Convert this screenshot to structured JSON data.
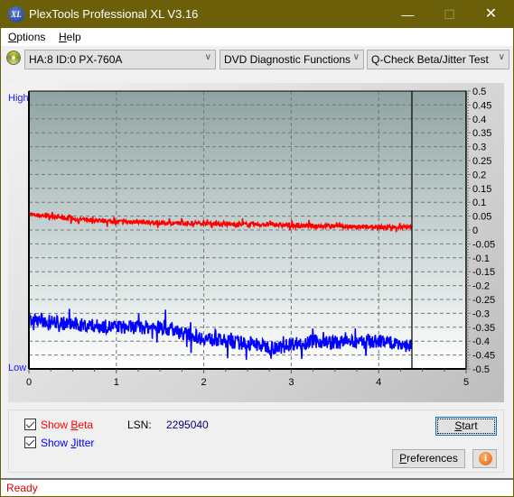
{
  "window": {
    "title": "PlexTools Professional XL V3.16",
    "app_icon_text": "XL",
    "controls": {
      "minimize": "—",
      "maximize": "☐",
      "close": "✕"
    }
  },
  "menu": [
    {
      "label": "Options",
      "mnemonic": "O"
    },
    {
      "label": "Help",
      "mnemonic": "H"
    }
  ],
  "toolbar": {
    "drive_select": "HA:8 ID:0  PX-760A",
    "function_select": "DVD Diagnostic Functions",
    "test_select": "Q-Check Beta/Jitter Test"
  },
  "chart_data": {
    "type": "line",
    "title": "",
    "left_axis_labels": {
      "high": "High",
      "low": "Low"
    },
    "xlabel": "",
    "ylabel": "",
    "xlim": [
      0,
      5
    ],
    "ylim": [
      -0.5,
      0.5
    ],
    "x_ticks": [
      0,
      1,
      2,
      3,
      4,
      5
    ],
    "y_ticks": [
      0.5,
      0.45,
      0.4,
      0.35,
      0.3,
      0.25,
      0.2,
      0.15,
      0.1,
      0.05,
      0,
      -0.05,
      -0.1,
      -0.15,
      -0.2,
      -0.25,
      -0.3,
      -0.35,
      -0.4,
      -0.45,
      -0.5
    ],
    "grid": true,
    "end_marker_x": 4.38,
    "series": [
      {
        "name": "Beta",
        "color": "#ff0000",
        "x": [
          0,
          0.25,
          0.5,
          0.75,
          1.0,
          1.25,
          1.5,
          1.75,
          2.0,
          2.25,
          2.5,
          2.75,
          3.0,
          3.25,
          3.5,
          3.75,
          4.0,
          4.25,
          4.38
        ],
        "values": [
          0.055,
          0.05,
          0.04,
          0.035,
          0.03,
          0.03,
          0.025,
          0.025,
          0.025,
          0.02,
          0.02,
          0.02,
          0.015,
          0.015,
          0.015,
          0.01,
          0.01,
          0.01,
          0.01
        ],
        "noise": 0.008
      },
      {
        "name": "Jitter",
        "color": "#0000ff",
        "x": [
          0,
          0.25,
          0.5,
          0.75,
          1.0,
          1.25,
          1.5,
          1.75,
          2.0,
          2.25,
          2.5,
          2.75,
          2.85,
          3.0,
          3.25,
          3.5,
          3.75,
          4.0,
          4.25,
          4.38
        ],
        "values": [
          -0.32,
          -0.33,
          -0.34,
          -0.345,
          -0.35,
          -0.35,
          -0.35,
          -0.37,
          -0.39,
          -0.4,
          -0.41,
          -0.42,
          -0.425,
          -0.41,
          -0.4,
          -0.405,
          -0.405,
          -0.4,
          -0.41,
          -0.42
        ],
        "noise": 0.025
      }
    ]
  },
  "controls": {
    "show_beta": {
      "label_pre": "Show ",
      "mnemonic": "B",
      "label_post": "eta",
      "checked": true,
      "color": "#ff0000"
    },
    "show_jitter": {
      "label_pre": "Show ",
      "mnemonic": "J",
      "label_post": "itter",
      "checked": true,
      "color": "#0000ff"
    },
    "lsn_label": "LSN:",
    "lsn_value": "2295040",
    "start_button": {
      "mnemonic": "S",
      "rest": "tart"
    },
    "preferences_button": {
      "mnemonic": "P",
      "rest": "references"
    },
    "info_button": "i"
  },
  "status": {
    "text": "Ready"
  }
}
